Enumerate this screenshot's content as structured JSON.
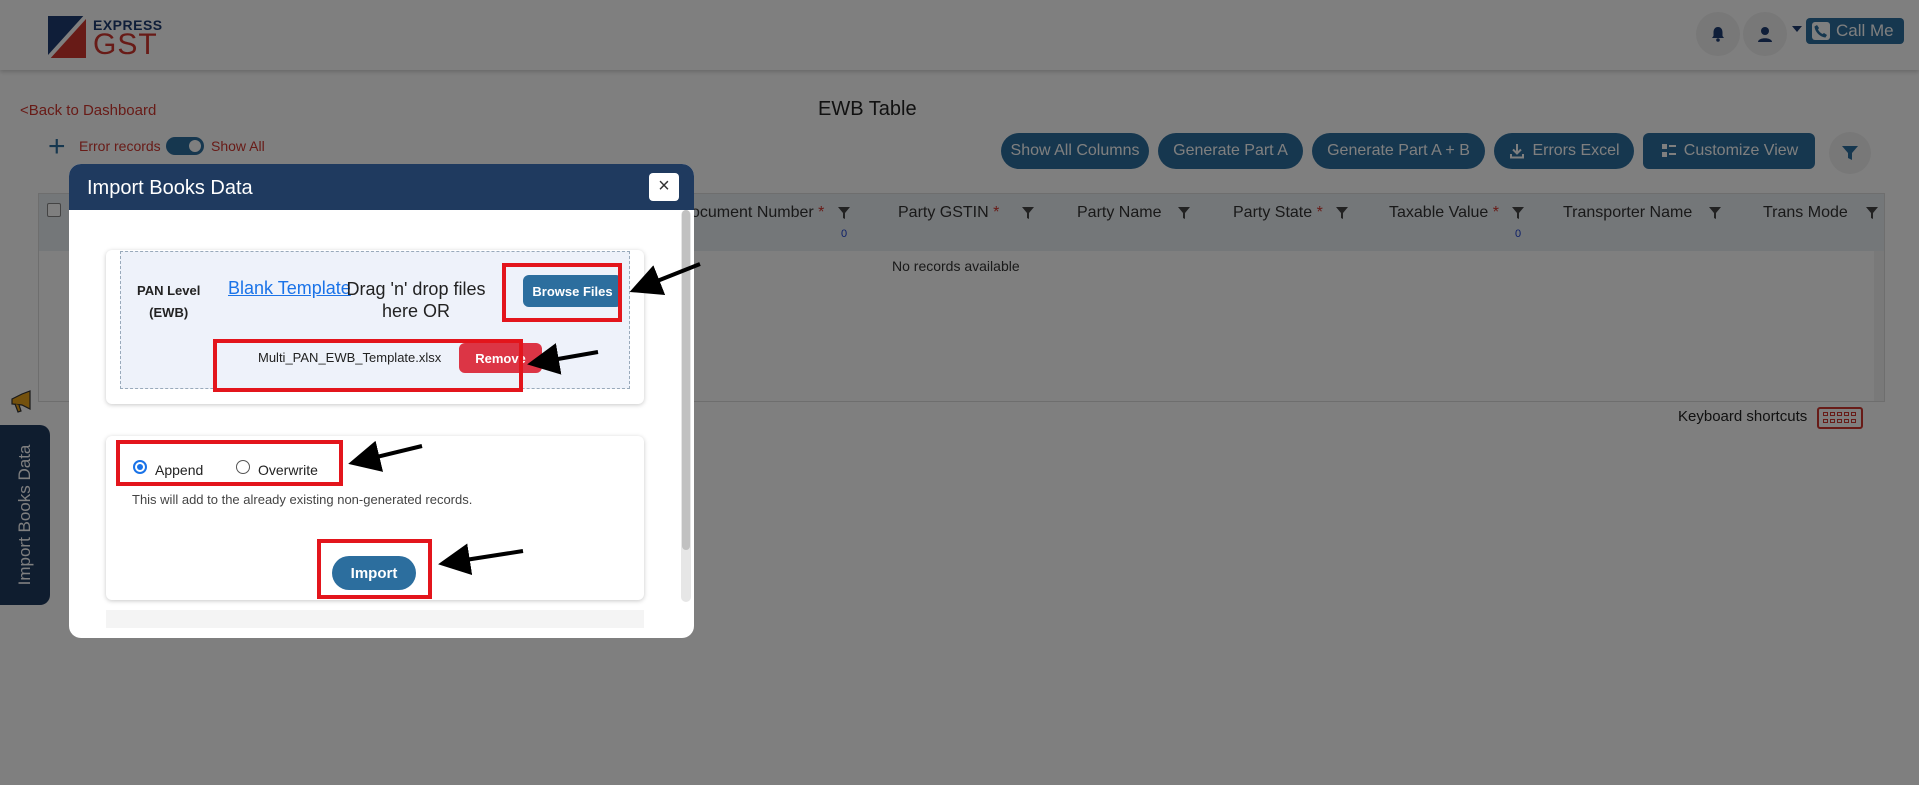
{
  "header": {
    "logo_top": "EXPRESS",
    "logo_bottom": "GST",
    "callme_label": "Call Me"
  },
  "page": {
    "back_link": "<Back to Dashboard",
    "title": "EWB Table",
    "error_records_label": "Error records",
    "show_all_label": "Show All",
    "toolbar": {
      "show_all_columns": "Show All Columns",
      "generate_part_a": "Generate Part A",
      "generate_part_ab": "Generate Part A + B",
      "errors_excel": "Errors Excel",
      "customize_view": "Customize View"
    },
    "table": {
      "columns": [
        {
          "label": "ocument Number",
          "required": "*",
          "count": "0"
        },
        {
          "label": "Party GSTIN",
          "required": "*"
        },
        {
          "label": "Party Name",
          "required": ""
        },
        {
          "label": "Party State",
          "required": "*"
        },
        {
          "label": "Taxable Value",
          "required": "*",
          "count": "0"
        },
        {
          "label": "Transporter Name",
          "required": ""
        },
        {
          "label": "Trans Mode",
          "required": ""
        }
      ],
      "empty_text": "No records available"
    },
    "keyboard_shortcuts": "Keyboard shortcuts",
    "side_tab": "Import Books Data"
  },
  "modal": {
    "title": "Import Books Data",
    "close": "×",
    "pan_level_line1": "PAN Level",
    "pan_level_line2": "(EWB)",
    "blank_template": "Blank Template",
    "drag_text": "Drag 'n' drop files here OR",
    "browse_files": "Browse Files",
    "file_name": "Multi_PAN_EWB_Template.xlsx",
    "remove": "Remove",
    "append": "Append",
    "overwrite": "Overwrite",
    "selected_mode": "Append",
    "hint": "This will add to the already existing non-generated records.",
    "import": "Import"
  },
  "colors": {
    "primary": "#2c6e9e",
    "navy": "#1f3a5f",
    "danger": "#dc3545",
    "annotation": "#e3151c"
  }
}
